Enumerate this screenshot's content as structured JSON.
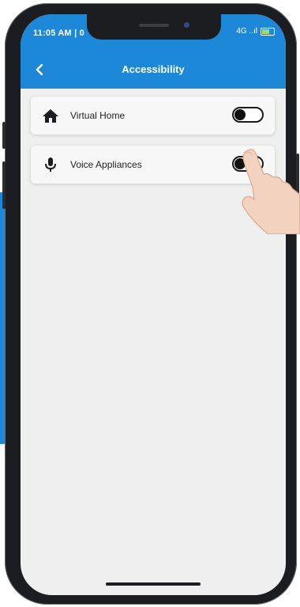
{
  "status_bar": {
    "time": "11:05 AM | 0",
    "network": "4G ..ıl"
  },
  "app_bar": {
    "title": "Accessibility",
    "back_icon": "chevron-left-icon"
  },
  "settings": [
    {
      "label": "Virtual Home",
      "icon": "home-icon",
      "toggle_on": false
    },
    {
      "label": "Voice Appliances",
      "icon": "microphone-icon",
      "toggle_on": false
    }
  ],
  "colors": {
    "accent": "#1e88d8",
    "screen_bg": "#efefef",
    "card_bg": "#f7f7f7",
    "frame": "#1b1d20"
  }
}
